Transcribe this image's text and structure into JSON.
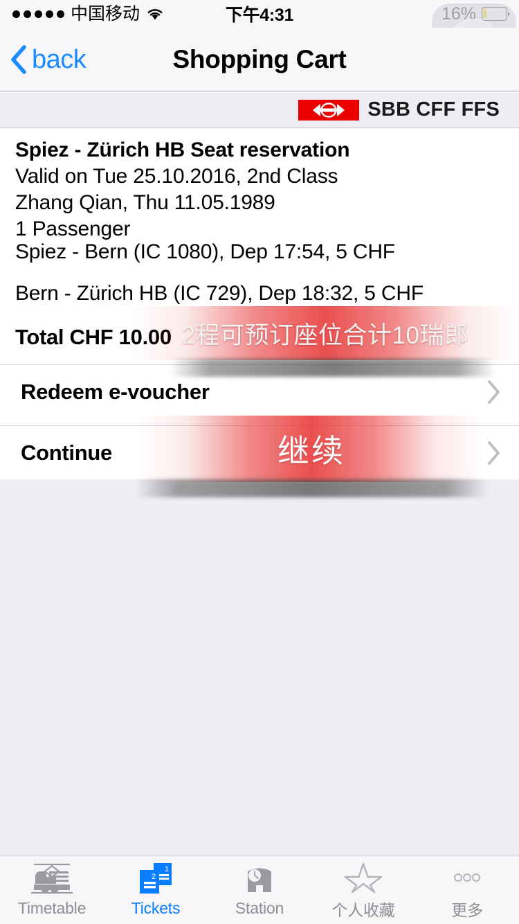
{
  "status_bar": {
    "signal_dots": 5,
    "carrier": "中国移动",
    "wifi_icon": "wifi-icon",
    "time": "下午4:31",
    "battery_percent_label": "16%",
    "battery_level": 16,
    "battery_color": "#ffcc00"
  },
  "assistive_touch": {
    "icon": "assistive-touch-button"
  },
  "nav_bar": {
    "back_label": "back",
    "back_icon": "chevron-left-icon",
    "title": "Shopping Cart",
    "accent_color": "#1a8cff"
  },
  "brand_bar": {
    "logo_mark_icon": "sbb-double-arrow-icon",
    "wordmark": "SBB CFF FFS",
    "logo_red": "#eb0000"
  },
  "cart": {
    "summary": {
      "title": "Spiez - Zürich HB Seat reservation",
      "lines": [
        "Valid on Tue 25.10.2016, 2nd Class",
        "Zhang Qian, Thu 11.05.1989",
        "1 Passenger"
      ]
    },
    "legs": [
      "Spiez - Bern (IC 1080), Dep 17:54, 5 CHF",
      "Bern - Zürich HB (IC 729), Dep 18:32, 5 CHF"
    ],
    "total_label": "Total CHF 10.00",
    "rows": [
      {
        "label": "Redeem e-voucher",
        "chevron_icon": "chevron-right-icon"
      },
      {
        "label": "Continue",
        "chevron_icon": "chevron-right-icon"
      }
    ]
  },
  "annotations": [
    {
      "text": "2程可预订座位合计10瑞郎",
      "color": "#f2f2f2",
      "band_color": "#e62828"
    },
    {
      "text": "继续",
      "color": "#ffffff",
      "band_color": "#e62828"
    }
  ],
  "tab_bar": {
    "active_index": 1,
    "active_color": "#0a7cff",
    "inactive_color": "#8e8e93",
    "items": [
      {
        "label": "Timetable",
        "icon": "train-icon"
      },
      {
        "label": "Tickets",
        "icon": "tickets-icon"
      },
      {
        "label": "Station",
        "icon": "station-clock-icon"
      },
      {
        "label": "个人收藏",
        "icon": "star-icon"
      },
      {
        "label": "更多",
        "icon": "more-dots-icon"
      }
    ]
  }
}
